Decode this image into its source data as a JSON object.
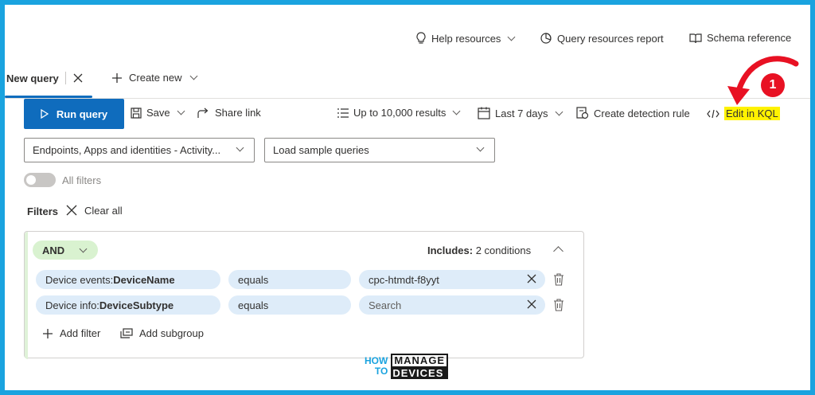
{
  "topbar": {
    "help_resources": "Help resources",
    "query_resources_report": "Query resources report",
    "schema_reference": "Schema reference"
  },
  "tabs": {
    "active_label": "New query",
    "create_new_label": "Create new"
  },
  "toolbar": {
    "run_query": "Run query",
    "save": "Save",
    "share_link": "Share link",
    "results_limit": "Up to 10,000 results",
    "time_range": "Last 7 days",
    "create_detection_rule": "Create detection rule",
    "edit_in_kql": "Edit in KQL"
  },
  "selectors": {
    "data_source": "Endpoints, Apps and identities - Activity...",
    "sample_queries": "Load sample queries"
  },
  "filters": {
    "all_filters_label": "All filters",
    "filters_label": "Filters",
    "clear_all": "Clear all"
  },
  "group": {
    "operator": "AND",
    "includes_label": "Includes:",
    "includes_value": "2 conditions",
    "conditions": [
      {
        "field_prefix": "Device events: ",
        "field_name": "DeviceName",
        "operator": "equals",
        "value": "cpc-htmdt-f8yyt",
        "value_is_placeholder": false
      },
      {
        "field_prefix": "Device info: ",
        "field_name": "DeviceSubtype",
        "operator": "equals",
        "value": "Search",
        "value_is_placeholder": true
      }
    ],
    "add_filter": "Add filter",
    "add_subgroup": "Add subgroup"
  },
  "annotation": {
    "number": "1",
    "color": "#e81123"
  },
  "logo": {
    "how": "HOW",
    "to": "TO",
    "manage": "MANAGE",
    "devices": "DEVICES"
  },
  "colors": {
    "accent": "#0f6cbd",
    "highlight": "#fff200",
    "border_frame": "#1aa3df"
  }
}
